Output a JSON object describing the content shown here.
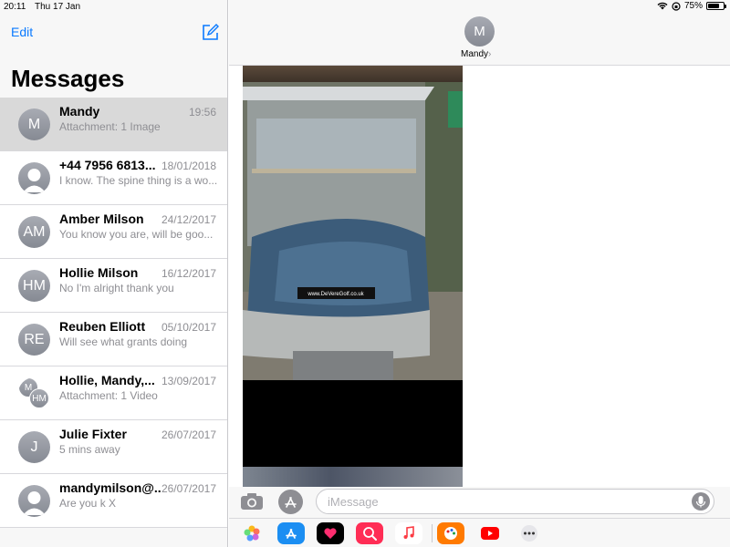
{
  "status": {
    "time": "20:11",
    "date": "Thu 17 Jan",
    "battery": "75%",
    "battery_level": 0.75
  },
  "sidebar": {
    "edit_label": "Edit",
    "title": "Messages",
    "conversations": [
      {
        "initials": "M",
        "name": "Mandy",
        "time": "19:56",
        "preview": "Attachment: 1 Image",
        "selected": true
      },
      {
        "initials": "",
        "name": "+44 7956 6813...",
        "time": "18/01/2018",
        "preview": "I know. The spine thing is a wo..."
      },
      {
        "initials": "AM",
        "name": "Amber Milson",
        "time": "24/12/2017",
        "preview": "You know you are, will be goo..."
      },
      {
        "initials": "HM",
        "name": "Hollie Milson",
        "time": "16/12/2017",
        "preview": "No I'm alright thank you"
      },
      {
        "initials": "RE",
        "name": "Reuben Elliott",
        "time": "05/10/2017",
        "preview": "Will see what grants doing"
      },
      {
        "initials": "HM",
        "initials_back": "M",
        "name": "Hollie, Mandy,...",
        "time": "13/09/2017",
        "preview": "Attachment: 1 Video"
      },
      {
        "initials": "J",
        "name": "Julie Fixter",
        "time": "26/07/2017",
        "preview": "5 mins away"
      },
      {
        "initials": "",
        "name": "mandymilson@...",
        "time": "26/07/2017",
        "preview": "Are you k X"
      }
    ]
  },
  "conversation": {
    "contact_initial": "M",
    "contact_name": "Mandy",
    "photo_caption": "www.DeVereGolf.co.uk"
  },
  "composer": {
    "placeholder": "iMessage"
  },
  "apps": [
    "photos-icon",
    "app-store-icon",
    "digital-touch-icon",
    "search-images-icon",
    "music-icon",
    "paint-icon",
    "youtube-icon",
    "more-icon"
  ]
}
